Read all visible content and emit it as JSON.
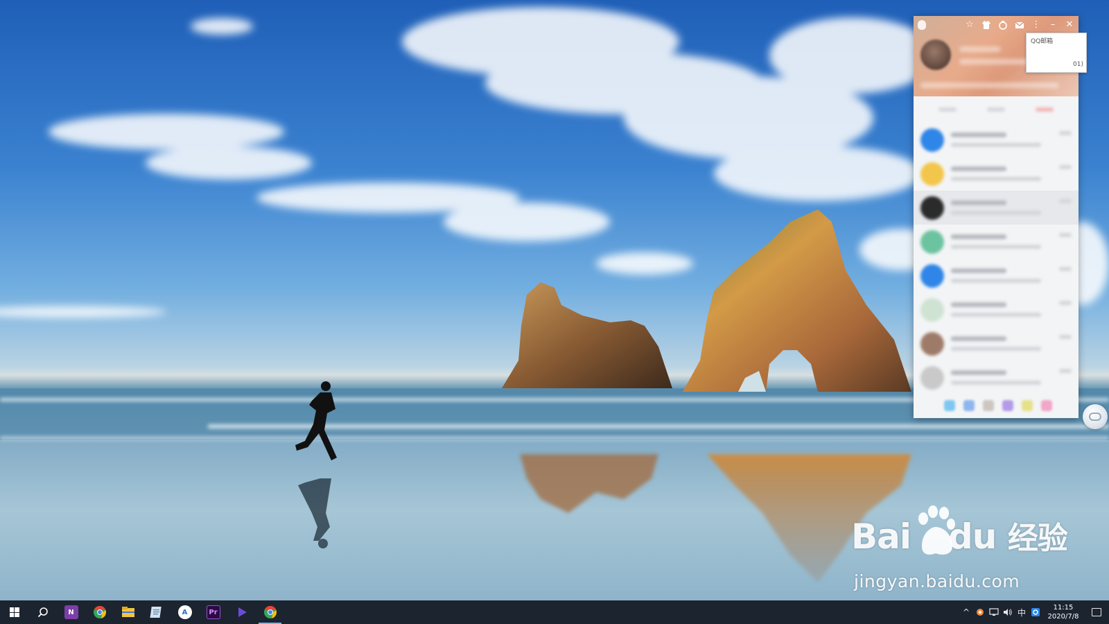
{
  "desktop": {
    "wallpaper": "beach-with-sea-stacks-and-runner"
  },
  "qq_panel": {
    "titlebar_icons": [
      "qq-penguin-icon",
      "star-icon",
      "skin-shirt-icon",
      "app-box-icon",
      "mail-icon",
      "more-vertical-icon",
      "minimize-icon",
      "close-icon"
    ],
    "tooltip": {
      "line1": "QQ邮箱",
      "line2": "01)"
    },
    "contacts": [
      {
        "avatar_color": "#2f86e8",
        "selected": false
      },
      {
        "avatar_color": "#f2c64a",
        "selected": false
      },
      {
        "avatar_color": "#2b2b2b",
        "selected": true
      },
      {
        "avatar_color": "#6cc3a0",
        "selected": false
      },
      {
        "avatar_color": "#2f86e8",
        "selected": false
      },
      {
        "avatar_color": "#cfe3d2",
        "selected": false
      },
      {
        "avatar_color": "#9e7b68",
        "selected": false
      },
      {
        "avatar_color": "#c9c9c9",
        "selected": false
      }
    ],
    "bottom_icon_colors": [
      "#7ec8f0",
      "#8fb5ef",
      "#cbc7c0",
      "#b49be8",
      "#e7e08a",
      "#f2a6c8"
    ]
  },
  "watermark": {
    "logo_left": "Bai",
    "logo_right": "du",
    "logo_cn": "经验",
    "url": "jingyan.baidu.com"
  },
  "taskbar": {
    "pinned": [
      {
        "name": "search-icon",
        "label": ""
      },
      {
        "name": "onenote-icon",
        "label": "N",
        "color": "#7b3fa8"
      },
      {
        "name": "chrome-icon",
        "label": "",
        "color": "#e94335"
      },
      {
        "name": "file-explorer-icon",
        "label": "",
        "color": "#f4c542"
      },
      {
        "name": "notepad-icon",
        "label": "",
        "color": "#8fb9d9"
      },
      {
        "name": "app-a-icon",
        "label": "A",
        "color": "#ffffff"
      },
      {
        "name": "premiere-icon",
        "label": "Pr",
        "color": "#2a0b44"
      },
      {
        "name": "media-player-icon",
        "label": "",
        "color": "#6a4bd6"
      },
      {
        "name": "chrome-active-icon",
        "label": "",
        "color": "#e94335"
      }
    ],
    "tray": {
      "ime": "中",
      "time": "11:15",
      "date": "2020/7/8"
    }
  }
}
